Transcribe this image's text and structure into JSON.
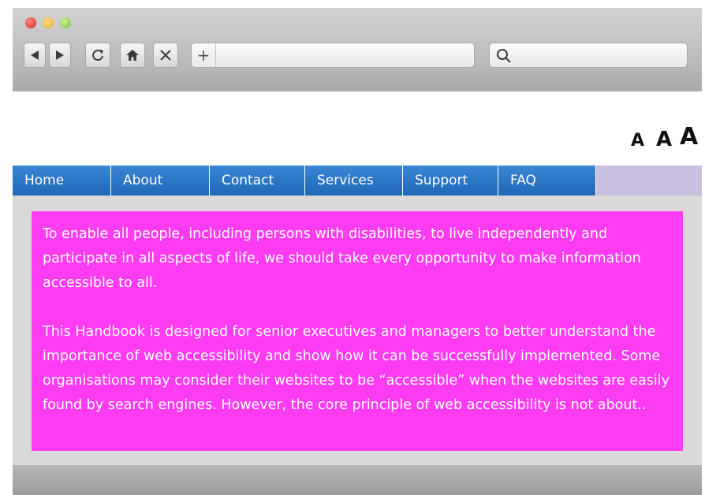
{
  "browser": {
    "address_plus": "+",
    "address_value": "",
    "search_value": ""
  },
  "text_size": {
    "small": "A",
    "medium": "A",
    "large": "A"
  },
  "nav": {
    "items": [
      {
        "label": "Home"
      },
      {
        "label": "About"
      },
      {
        "label": "Contact"
      },
      {
        "label": "Services"
      },
      {
        "label": "Support"
      },
      {
        "label": "FAQ"
      }
    ]
  },
  "content": {
    "paragraph_1": "To enable all people, including persons with disabilities, to live independently and participate in all aspects of life, we should take every opportunity to make information accessible to all.",
    "paragraph_2": "This Handbook is designed for senior executives and managers to better understand the importance of web accessibility and show how it can be successfully implemented. Some organisations may consider their websites to be “accessible” when the websites are easily found by search engines. However, the core principle of web accessibility is not about.."
  },
  "colors": {
    "nav_blue": "#2a77c9",
    "content_magenta": "#ff3cf2",
    "nav_fill": "#c9bfe0"
  }
}
